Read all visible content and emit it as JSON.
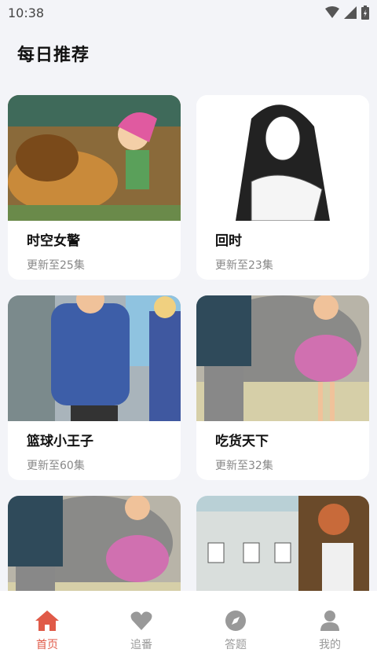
{
  "status": {
    "time": "10:38"
  },
  "header": {
    "title": "每日推荐"
  },
  "cards": [
    {
      "title": "时空女警",
      "subtitle": "更新至25集"
    },
    {
      "title": "回时",
      "subtitle": "更新至23集"
    },
    {
      "title": "篮球小王子",
      "subtitle": "更新至60集"
    },
    {
      "title": "吃货天下",
      "subtitle": "更新至32集"
    },
    {
      "title": "",
      "subtitle": ""
    },
    {
      "title": "",
      "subtitle": ""
    }
  ],
  "tabs": [
    {
      "label": "首页",
      "icon": "home-icon",
      "active": true
    },
    {
      "label": "追番",
      "icon": "heart-icon",
      "active": false
    },
    {
      "label": "答题",
      "icon": "compass-icon",
      "active": false
    },
    {
      "label": "我的",
      "icon": "user-icon",
      "active": false
    }
  ],
  "colors": {
    "accent": "#e05a48",
    "inactive": "#999999",
    "background": "#f3f4f8"
  }
}
